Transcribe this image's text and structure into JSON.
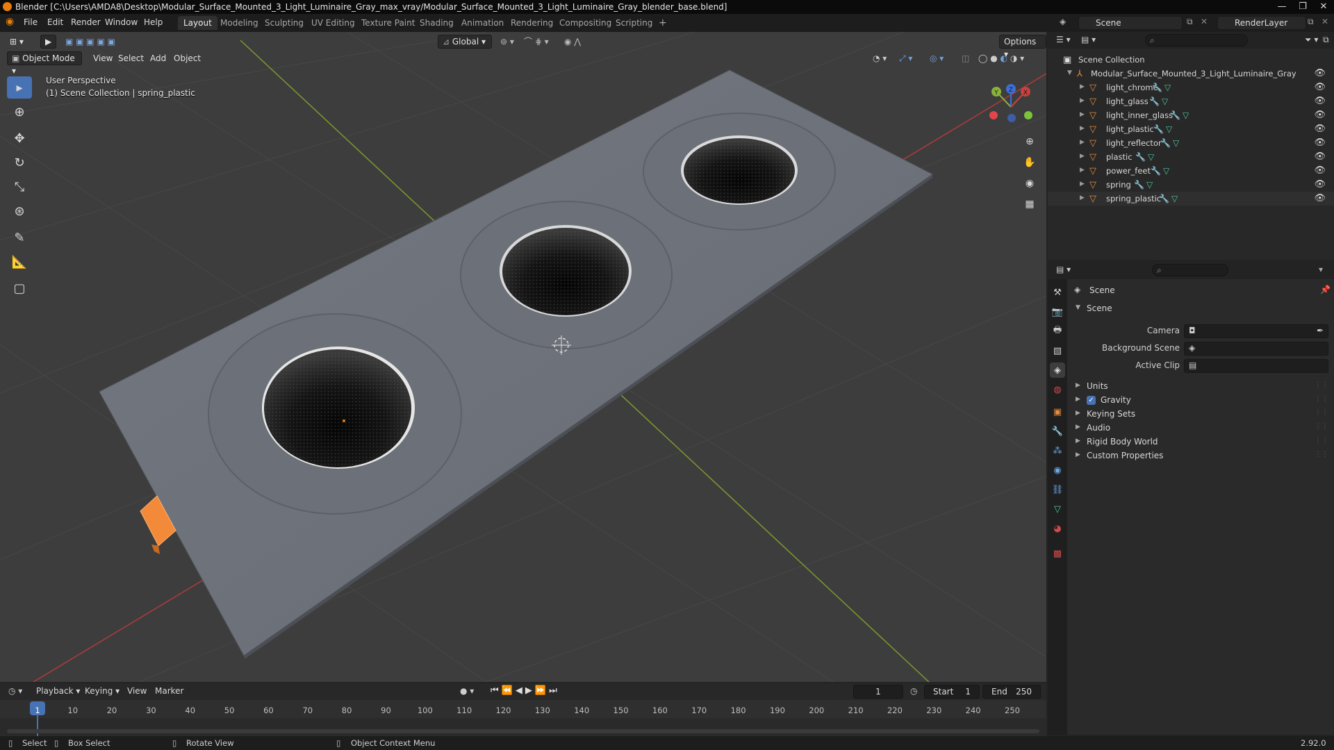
{
  "window": {
    "title": "Blender [C:\\Users\\AMDA8\\Desktop\\Modular_Surface_Mounted_3_Light_Luminaire_Gray_max_vray/Modular_Surface_Mounted_3_Light_Luminaire_Gray_blender_base.blend]",
    "minimize": "—",
    "maximize": "❐",
    "close": "✕"
  },
  "menu": {
    "file": "File",
    "edit": "Edit",
    "render": "Render",
    "window": "Window",
    "help": "Help"
  },
  "workspaces": [
    "Layout",
    "Modeling",
    "Sculpting",
    "UV Editing",
    "Texture Paint",
    "Shading",
    "Animation",
    "Rendering",
    "Compositing",
    "Scripting"
  ],
  "active_workspace": "Layout",
  "add_workspace": "+",
  "scene_selector": {
    "value": "Scene"
  },
  "render_layer": {
    "value": "RenderLayer"
  },
  "viewport": {
    "mode": "Object Mode",
    "menu": {
      "view": "View",
      "select": "Select",
      "add": "Add",
      "object": "Object"
    },
    "transform_orientation": "Global",
    "options": "Options",
    "perspective_label": "User Perspective",
    "collection_label": "(1) Scene Collection | spring_plastic",
    "gizmo": {
      "x": "X",
      "y": "Y",
      "z": "Z"
    }
  },
  "outliner": {
    "root": "Scene Collection",
    "collection": "Modular_Surface_Mounted_3_Light_Luminaire_Gray",
    "objects": [
      "light_chrome",
      "light_glass",
      "light_inner_glass",
      "light_plastic",
      "light_reflector",
      "plastic",
      "power_feet",
      "spring",
      "spring_plastic"
    ]
  },
  "properties": {
    "context": "Scene",
    "panel_title": "Scene",
    "camera_label": "Camera",
    "background_scene_label": "Background Scene",
    "active_clip_label": "Active Clip",
    "subpanels": [
      "Units",
      "Gravity",
      "Keying Sets",
      "Audio",
      "Rigid Body World",
      "Custom Properties"
    ],
    "gravity_checked": true
  },
  "timeline": {
    "menu": {
      "playback": "Playback",
      "keying": "Keying",
      "view": "View",
      "marker": "Marker"
    },
    "current_frame": "1",
    "start_label": "Start",
    "start_value": "1",
    "end_label": "End",
    "end_value": "250",
    "ticks": [
      "1",
      "10",
      "20",
      "30",
      "40",
      "50",
      "60",
      "70",
      "80",
      "90",
      "100",
      "110",
      "120",
      "130",
      "140",
      "150",
      "160",
      "170",
      "180",
      "190",
      "200",
      "210",
      "220",
      "230",
      "240",
      "250"
    ]
  },
  "statusbar": {
    "select": "Select",
    "box_select": "Box Select",
    "rotate_view": "Rotate View",
    "context_menu": "Object Context Menu",
    "version": "2.92.0"
  },
  "colors": {
    "accent": "#4772b3",
    "object_orange": "#e38b3f",
    "axis_x": "#c8413e",
    "axis_y": "#8ab13a",
    "panel_gray": "#6f737a"
  }
}
